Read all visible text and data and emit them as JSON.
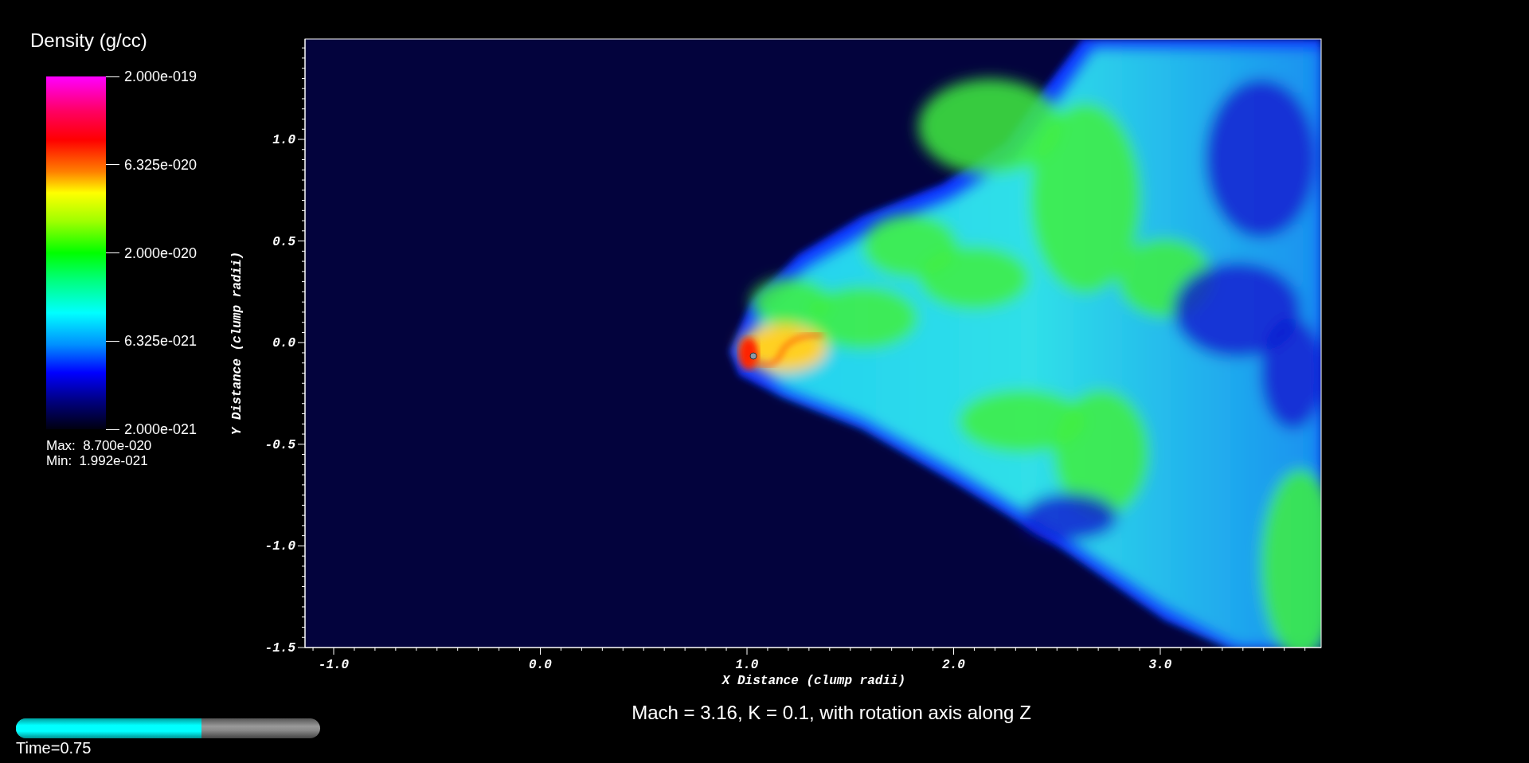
{
  "legend": {
    "title": "Density (g/cc)",
    "labels": [
      "2.000e-019",
      "6.325e-020",
      "2.000e-020",
      "6.325e-021",
      "2.000e-021"
    ],
    "max": "Max:  8.700e-020",
    "min": "Min:  1.992e-021"
  },
  "plot": {
    "x_axis": {
      "title": "X Distance (clump radii)",
      "ticks": [
        "-1.0",
        "0.0",
        "1.0",
        "2.0",
        "3.0"
      ]
    },
    "y_axis": {
      "title": "Y Distance (clump radii)",
      "ticks": [
        "1.0",
        "0.5",
        "0.0",
        "-0.5",
        "-1.0",
        "-1.5"
      ]
    }
  },
  "caption": "Mach = 3.16, K = 0.1, with rotation axis along Z",
  "time_slider": {
    "level": 0.61,
    "label": "Time=0.75"
  }
}
